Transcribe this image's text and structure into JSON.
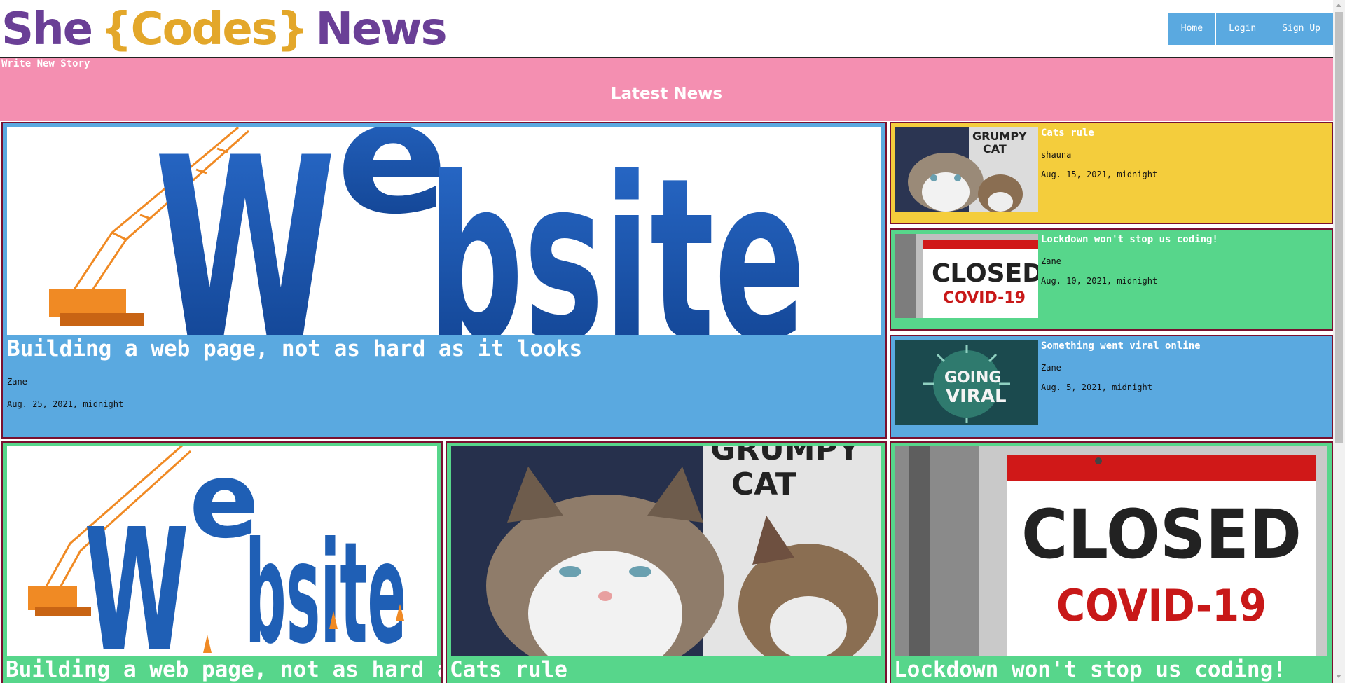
{
  "header": {
    "logo": {
      "she": "She",
      "codes": "{Codes}",
      "news": "News"
    },
    "nav": [
      {
        "label": "Home"
      },
      {
        "label": "Login"
      },
      {
        "label": "Sign Up"
      }
    ]
  },
  "band": {
    "write_link": "Write New Story",
    "title": "Latest News"
  },
  "featured": {
    "image_text": "Website",
    "title": "Building a web page, not as hard as it looks",
    "author": "Zane",
    "date": "Aug. 25, 2021, midnight"
  },
  "side_stories": [
    {
      "title": "Cats rule",
      "author": "shauna",
      "date": "Aug. 15, 2021, midnight",
      "image_text": "GRUMPY CAT"
    },
    {
      "title": "Lockdown won't stop us coding!",
      "author": "Zane",
      "date": "Aug. 10, 2021, midnight",
      "image_text_1": "CLOSED",
      "image_text_2": "COVID-19"
    },
    {
      "title": "Something went viral online",
      "author": "Zane",
      "date": "Aug. 5, 2021, midnight",
      "image_text_1": "GOING",
      "image_text_2": "VIRAL"
    }
  ],
  "grid_stories": [
    {
      "title": "Building a web page, not as hard as",
      "image_text": "Website"
    },
    {
      "title": "Cats rule",
      "image_text": "GRUMPY CAT"
    },
    {
      "title": "Lockdown won't stop us coding!",
      "image_text_1": "CLOSED",
      "image_text_2": "COVID-19"
    }
  ],
  "colors": {
    "purple": "#6a3f96",
    "gold": "#e3a72a",
    "pink": "#f48fb1",
    "blue": "#5aa9e0",
    "green": "#57d68b",
    "yellow": "#f4cd3c"
  }
}
